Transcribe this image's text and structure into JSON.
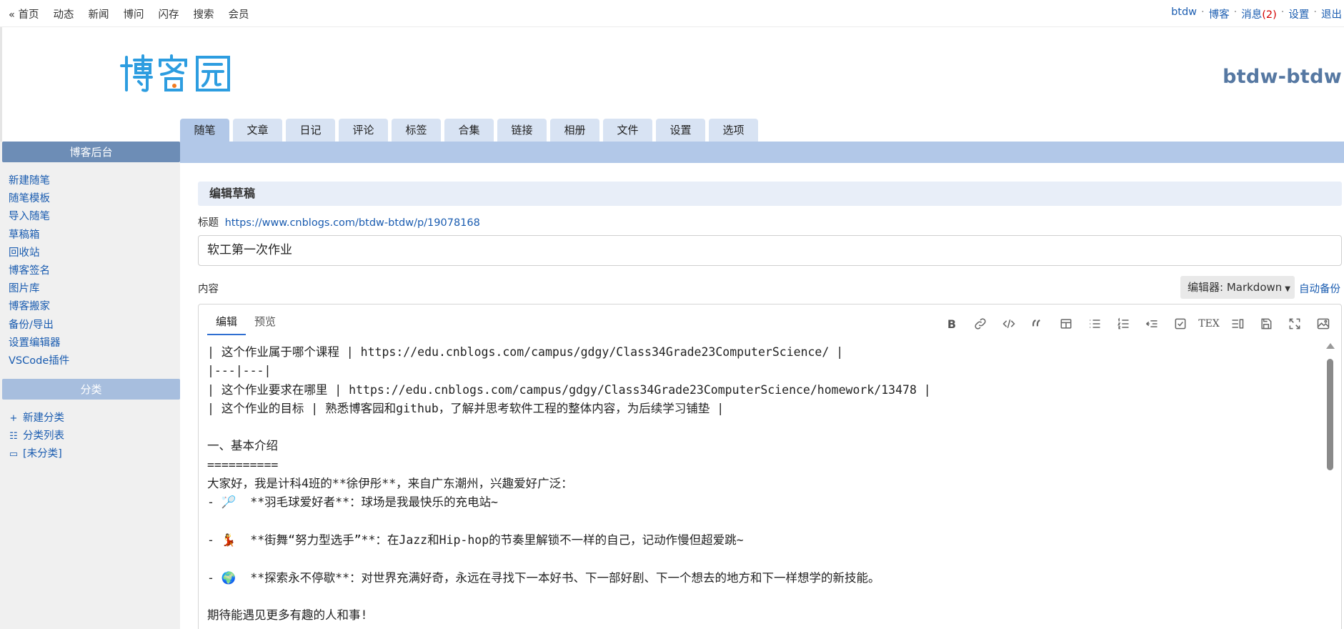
{
  "top_nav": {
    "left": [
      "« 首页",
      "动态",
      "新闻",
      "博问",
      "闪存",
      "搜索",
      "会员"
    ],
    "right": {
      "user": "btdw",
      "blog": "博客",
      "msg": "消息",
      "msg_count": "(2)",
      "settings": "设置",
      "logout": "退出",
      "sep": "·"
    }
  },
  "logo_text": "博客园",
  "blog_name": "btdw-btdw",
  "tabs": [
    "随笔",
    "文章",
    "日记",
    "评论",
    "标签",
    "合集",
    "链接",
    "相册",
    "文件",
    "设置",
    "选项"
  ],
  "sidebar": {
    "header": "博客后台",
    "links": [
      "新建随笔",
      "随笔模板",
      "导入随笔",
      "草稿箱",
      "回收站",
      "博客签名",
      "图片库",
      "博客搬家",
      "备份/导出",
      "设置编辑器",
      "VSCode插件"
    ],
    "category_header": "分类",
    "categories": [
      {
        "icon": "plus-icon",
        "label": "新建分类"
      },
      {
        "icon": "list-icon",
        "label": "分类列表"
      },
      {
        "icon": "folder-icon",
        "label": "[未分类]"
      }
    ]
  },
  "main": {
    "section_title": "编辑草稿",
    "title_label": "标题",
    "title_url": "https://www.cnblogs.com/btdw-btdw/p/19078168",
    "title_value": "软工第一次作业",
    "content_label": "内容",
    "editor_select": "编辑器: Markdown",
    "autosave": "自动备份",
    "editor_tabs": [
      "编辑",
      "预览"
    ],
    "toolbar": [
      "bold-icon",
      "link-icon",
      "code-icon",
      "quote-icon",
      "table-icon",
      "bullet-list-icon",
      "numbered-list-icon",
      "tree-icon",
      "task-icon",
      "tex-icon",
      "toc-icon",
      "save-icon",
      "fullscreen-icon",
      "image-icon"
    ],
    "toolbar_text": {
      "bold": "B",
      "tex": "TEX"
    },
    "lines": [
      "| 这个作业属于哪个课程 | https://edu.cnblogs.com/campus/gdgy/Class34Grade23ComputerScience/ |",
      "|---|---|",
      "| 这个作业要求在哪里 | https://edu.cnblogs.com/campus/gdgy/Class34Grade23ComputerScience/homework/13478 |",
      "| 这个作业的目标 | 熟悉博客园和github，了解并思考软件工程的整体内容，为后续学习铺垫 |",
      "",
      "一、基本介绍",
      "==========",
      "大家好，我是计科4班的**徐伊彤**，来自广东潮州，兴趣爱好广泛：",
      "- 🏸  **羽毛球爱好者**：球场是我最快乐的充电站~",
      "",
      "- 💃  **街舞“努力型选手”**：在Jazz和Hip-hop的节奏里解锁不一样的自己，记动作慢但超爱跳~",
      "",
      "- 🌍  **探索永不停歇**：对世界充满好奇，永远在寻找下一本好书、下一部好剧、下一个想去的地方和下一样想学的新技能。",
      "",
      "期待能遇见更多有趣的人和事!"
    ]
  },
  "colors": {
    "link": "#1a5cb0",
    "tab": "#d8e3f3",
    "tab_active": "#b2c8e8",
    "sidebar_header": "#6d8db6",
    "count": "#d40000"
  }
}
